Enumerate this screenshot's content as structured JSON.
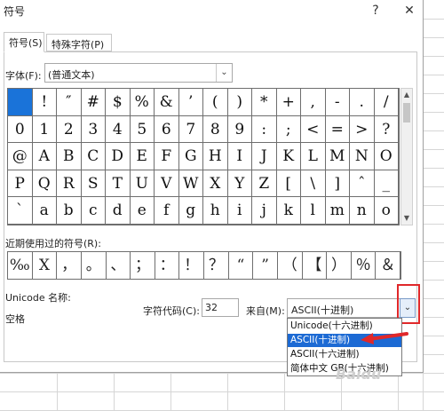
{
  "window": {
    "title": "符号",
    "help_label": "?",
    "close_label": "✕"
  },
  "tabs": [
    {
      "label": "符号(S)",
      "active": true
    },
    {
      "label": "特殊字符(P)",
      "active": false
    }
  ],
  "font": {
    "label": "字体(F):",
    "value": "(普通文本)"
  },
  "symbol_grid": {
    "rows": [
      [
        " ",
        "!",
        "″",
        "#",
        "$",
        "%",
        "&",
        "’",
        "(",
        ")",
        "*",
        "+",
        ",",
        "-",
        ".",
        "/"
      ],
      [
        "0",
        "1",
        "2",
        "3",
        "4",
        "5",
        "6",
        "7",
        "8",
        "9",
        ":",
        ";",
        "<",
        "=",
        ">",
        "?"
      ],
      [
        "@",
        "A",
        "B",
        "C",
        "D",
        "E",
        "F",
        "G",
        "H",
        "I",
        "J",
        "K",
        "L",
        "M",
        "N",
        "O"
      ],
      [
        "P",
        "Q",
        "R",
        "S",
        "T",
        "U",
        "V",
        "W",
        "X",
        "Y",
        "Z",
        "[",
        "\\",
        "]",
        "ˆ",
        "_"
      ],
      [
        "`",
        "a",
        "b",
        "c",
        "d",
        "e",
        "f",
        "g",
        "h",
        "i",
        "j",
        "k",
        "l",
        "m",
        "n",
        "o"
      ]
    ],
    "selected": "row0-col0"
  },
  "recent": {
    "label": "近期使用过的符号(R):",
    "symbols": [
      "‰",
      "X",
      "，",
      "。",
      "、",
      "；",
      "：",
      "！",
      "？",
      "“",
      "”",
      "（",
      "【",
      "）",
      "％",
      "＆"
    ]
  },
  "unicode_name": {
    "label": "Unicode 名称:",
    "value": "空格"
  },
  "char_code": {
    "label": "字符代码(C):",
    "value": "32"
  },
  "from": {
    "label": "来自(M):",
    "value": "ASCII(十进制)",
    "options": [
      "Unicode(十六进制)",
      "ASCII(十进制)",
      "ASCII(十六进制)",
      "简体中文 GB(十六进制)"
    ],
    "selected_index": 1
  },
  "colors": {
    "selection": "#1a73d9",
    "dropdown_selection": "#1c6ad4",
    "highlight_red": "#e0282a"
  },
  "watermark": "Baidu"
}
